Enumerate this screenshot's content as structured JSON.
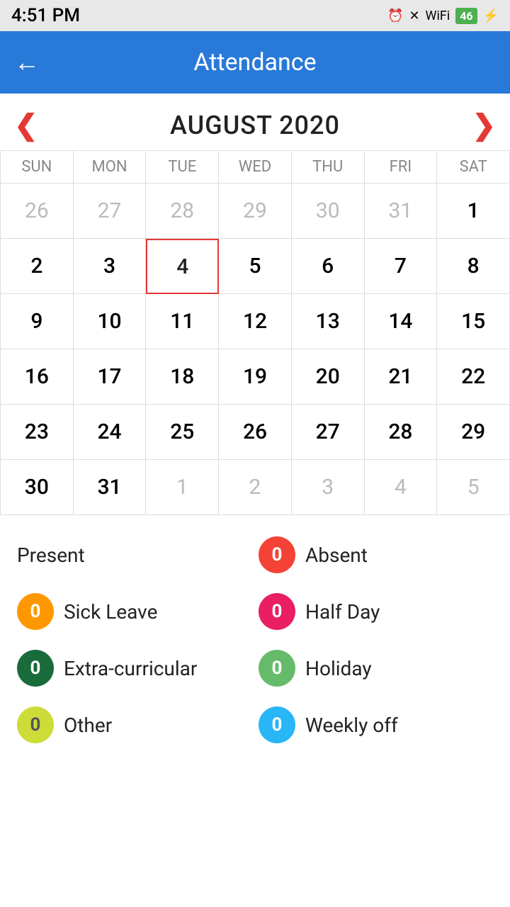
{
  "statusBar": {
    "time": "4:51 PM",
    "battery": "46"
  },
  "toolbar": {
    "title": "Attendance",
    "backLabel": "←"
  },
  "calendar": {
    "monthTitle": "AUGUST 2020",
    "prevArrow": "‹",
    "nextArrow": "›",
    "dayHeaders": [
      "SUN",
      "MON",
      "TUE",
      "WED",
      "THU",
      "FRI",
      "SAT"
    ],
    "weeks": [
      [
        {
          "day": "26",
          "otherMonth": true
        },
        {
          "day": "27",
          "otherMonth": true
        },
        {
          "day": "28",
          "otherMonth": true
        },
        {
          "day": "29",
          "otherMonth": true
        },
        {
          "day": "30",
          "otherMonth": true
        },
        {
          "day": "31",
          "otherMonth": true
        },
        {
          "day": "1",
          "otherMonth": false
        }
      ],
      [
        {
          "day": "2",
          "otherMonth": false
        },
        {
          "day": "3",
          "otherMonth": false
        },
        {
          "day": "4",
          "otherMonth": false,
          "current": true
        },
        {
          "day": "5",
          "otherMonth": false
        },
        {
          "day": "6",
          "otherMonth": false
        },
        {
          "day": "7",
          "otherMonth": false
        },
        {
          "day": "8",
          "otherMonth": false
        }
      ],
      [
        {
          "day": "9",
          "otherMonth": false
        },
        {
          "day": "10",
          "otherMonth": false
        },
        {
          "day": "11",
          "otherMonth": false
        },
        {
          "day": "12",
          "otherMonth": false
        },
        {
          "day": "13",
          "otherMonth": false
        },
        {
          "day": "14",
          "otherMonth": false
        },
        {
          "day": "15",
          "otherMonth": false
        }
      ],
      [
        {
          "day": "16",
          "otherMonth": false
        },
        {
          "day": "17",
          "otherMonth": false
        },
        {
          "day": "18",
          "otherMonth": false
        },
        {
          "day": "19",
          "otherMonth": false
        },
        {
          "day": "20",
          "otherMonth": false
        },
        {
          "day": "21",
          "otherMonth": false
        },
        {
          "day": "22",
          "otherMonth": false
        }
      ],
      [
        {
          "day": "23",
          "otherMonth": false
        },
        {
          "day": "24",
          "otherMonth": false
        },
        {
          "day": "25",
          "otherMonth": false
        },
        {
          "day": "26",
          "otherMonth": false
        },
        {
          "day": "27",
          "otherMonth": false
        },
        {
          "day": "28",
          "otherMonth": false
        },
        {
          "day": "29",
          "otherMonth": false
        }
      ],
      [
        {
          "day": "30",
          "otherMonth": false
        },
        {
          "day": "31",
          "otherMonth": false
        },
        {
          "day": "1",
          "otherMonth": true
        },
        {
          "day": "2",
          "otherMonth": true
        },
        {
          "day": "3",
          "otherMonth": true
        },
        {
          "day": "4",
          "otherMonth": true
        },
        {
          "day": "5",
          "otherMonth": true
        }
      ]
    ]
  },
  "legend": {
    "present": {
      "label": "Present",
      "count": null
    },
    "absent": {
      "label": "Absent",
      "count": "0",
      "badgeClass": "badge-absent"
    },
    "sickLeave": {
      "label": "Sick Leave",
      "count": "0",
      "badgeClass": "badge-sick"
    },
    "halfDay": {
      "label": "Half Day",
      "count": "0",
      "badgeClass": "badge-halfday"
    },
    "extraCurricular": {
      "label": "Extra-curricular",
      "count": "0",
      "badgeClass": "badge-extra"
    },
    "holiday": {
      "label": "Holiday",
      "count": "0",
      "badgeClass": "badge-holiday"
    },
    "other": {
      "label": "Other",
      "count": "0",
      "badgeClass": "badge-other"
    },
    "weeklyOff": {
      "label": "Weekly off",
      "count": "0",
      "badgeClass": "badge-weekly"
    }
  }
}
